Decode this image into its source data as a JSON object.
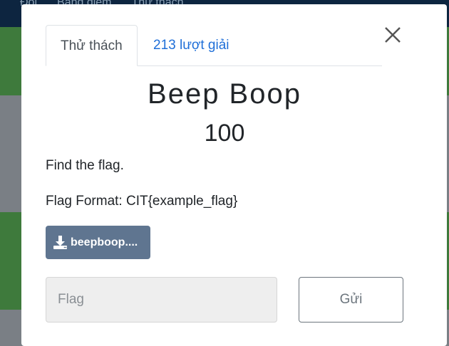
{
  "background": {
    "nav_items": [
      "Đội",
      "Bảng điểm",
      "Thử thách"
    ]
  },
  "modal": {
    "tabs": [
      {
        "label": "Thử thách",
        "active": true
      },
      {
        "label": "213 lượt giải",
        "active": false
      }
    ],
    "close_icon": "close-icon",
    "challenge": {
      "name": "Beep Boop",
      "value": "100",
      "description": [
        "Find the flag.",
        "Flag Format: CIT{example_flag}"
      ]
    },
    "file": {
      "icon": "download-icon",
      "label": "beepboop...."
    },
    "flag_input": {
      "placeholder": "Flag",
      "value": ""
    },
    "submit_label": "Gửi"
  },
  "colors": {
    "navbar": "#0d2540",
    "file_button": "#5f7590",
    "tab_link": "#1f6fd8",
    "overlay_green": "#3e7a3c"
  }
}
